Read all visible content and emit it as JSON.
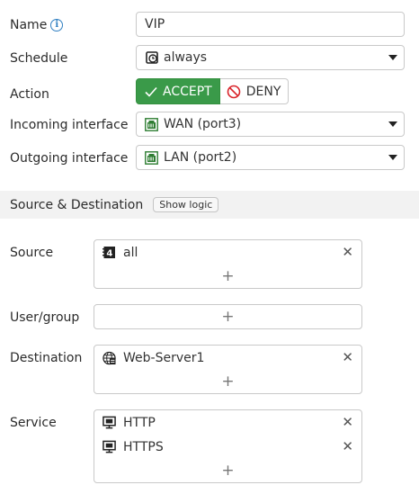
{
  "name": {
    "label": "Name",
    "value": "VIP"
  },
  "schedule": {
    "label": "Schedule",
    "value": "always",
    "icon": "clock-icon"
  },
  "action": {
    "label": "Action",
    "accept_label": "ACCEPT",
    "deny_label": "DENY",
    "selected": "ACCEPT",
    "accept_color": "#3a9a49"
  },
  "incoming": {
    "label": "Incoming interface",
    "value": "WAN (port3)",
    "icon": "network-port-icon"
  },
  "outgoing": {
    "label": "Outgoing interface",
    "value": "LAN (port2)",
    "icon": "network-port-icon"
  },
  "section": {
    "title": "Source & Destination",
    "logic_button": "Show logic"
  },
  "source": {
    "label": "Source",
    "items": [
      {
        "text": "all",
        "icon": "address-icon"
      }
    ]
  },
  "user_group": {
    "label": "User/group",
    "items": []
  },
  "destination": {
    "label": "Destination",
    "items": [
      {
        "text": "Web-Server1",
        "icon": "virtual-ip-icon"
      }
    ]
  },
  "service": {
    "label": "Service",
    "items": [
      {
        "text": "HTTP",
        "icon": "service-icon"
      },
      {
        "text": "HTTPS",
        "icon": "service-icon"
      }
    ]
  },
  "common": {
    "add_symbol": "+",
    "remove_symbol": "✕"
  }
}
